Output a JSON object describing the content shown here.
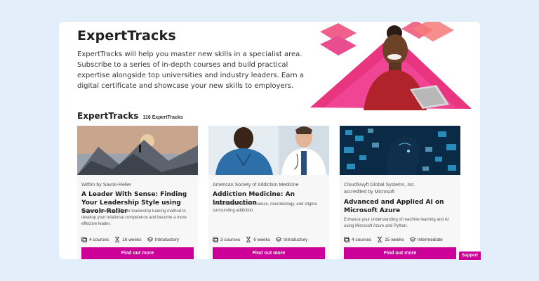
{
  "hero": {
    "title": "ExpertTracks",
    "description": "ExpertTracks will help you master new skills in a specialist area. Subscribe to a series of in-depth courses and build practical expertise alongside top universities and industry leaders. Earn a digital certificate and showcase your new skills to employers."
  },
  "section": {
    "title": "ExpertTracks",
    "count": "116 ExpertTracks"
  },
  "cards": [
    {
      "provider": "Within by Savoir-Relier",
      "title": "A Leader With Sense: Finding Your Leadership Style using Savoir-Relier",
      "description": "Discover the Savoir-Relier leadership training method to develop your relational competence and become a more effective leader.",
      "courses": "4 courses",
      "weeks": "16 weeks",
      "level": "Introductory",
      "button": "Find out more"
    },
    {
      "provider": "American Society of Addiction Medicine",
      "title": "Addiction Medicine: An Introduction",
      "description": "An introduction to the science, neurobiology, and stigma surrounding addiction.",
      "courses": "3 courses",
      "weeks": "6 weeks",
      "level": "Introductory",
      "button": "Find out more"
    },
    {
      "provider": "CloudSwyft Global Systems, Inc.",
      "provider2": "accredited by Microsoft",
      "title": "Advanced and Applied AI on Microsoft Azure",
      "description": "Enhance your understanding of machine learning and AI using Microsoft Azure and Python.",
      "courses": "4 courses",
      "weeks": "15 weeks",
      "level": "Intermediate",
      "button": "Find out more"
    }
  ],
  "support": {
    "label": "Support"
  },
  "colors": {
    "accent": "#cc0099",
    "background": "#e3eefb"
  }
}
